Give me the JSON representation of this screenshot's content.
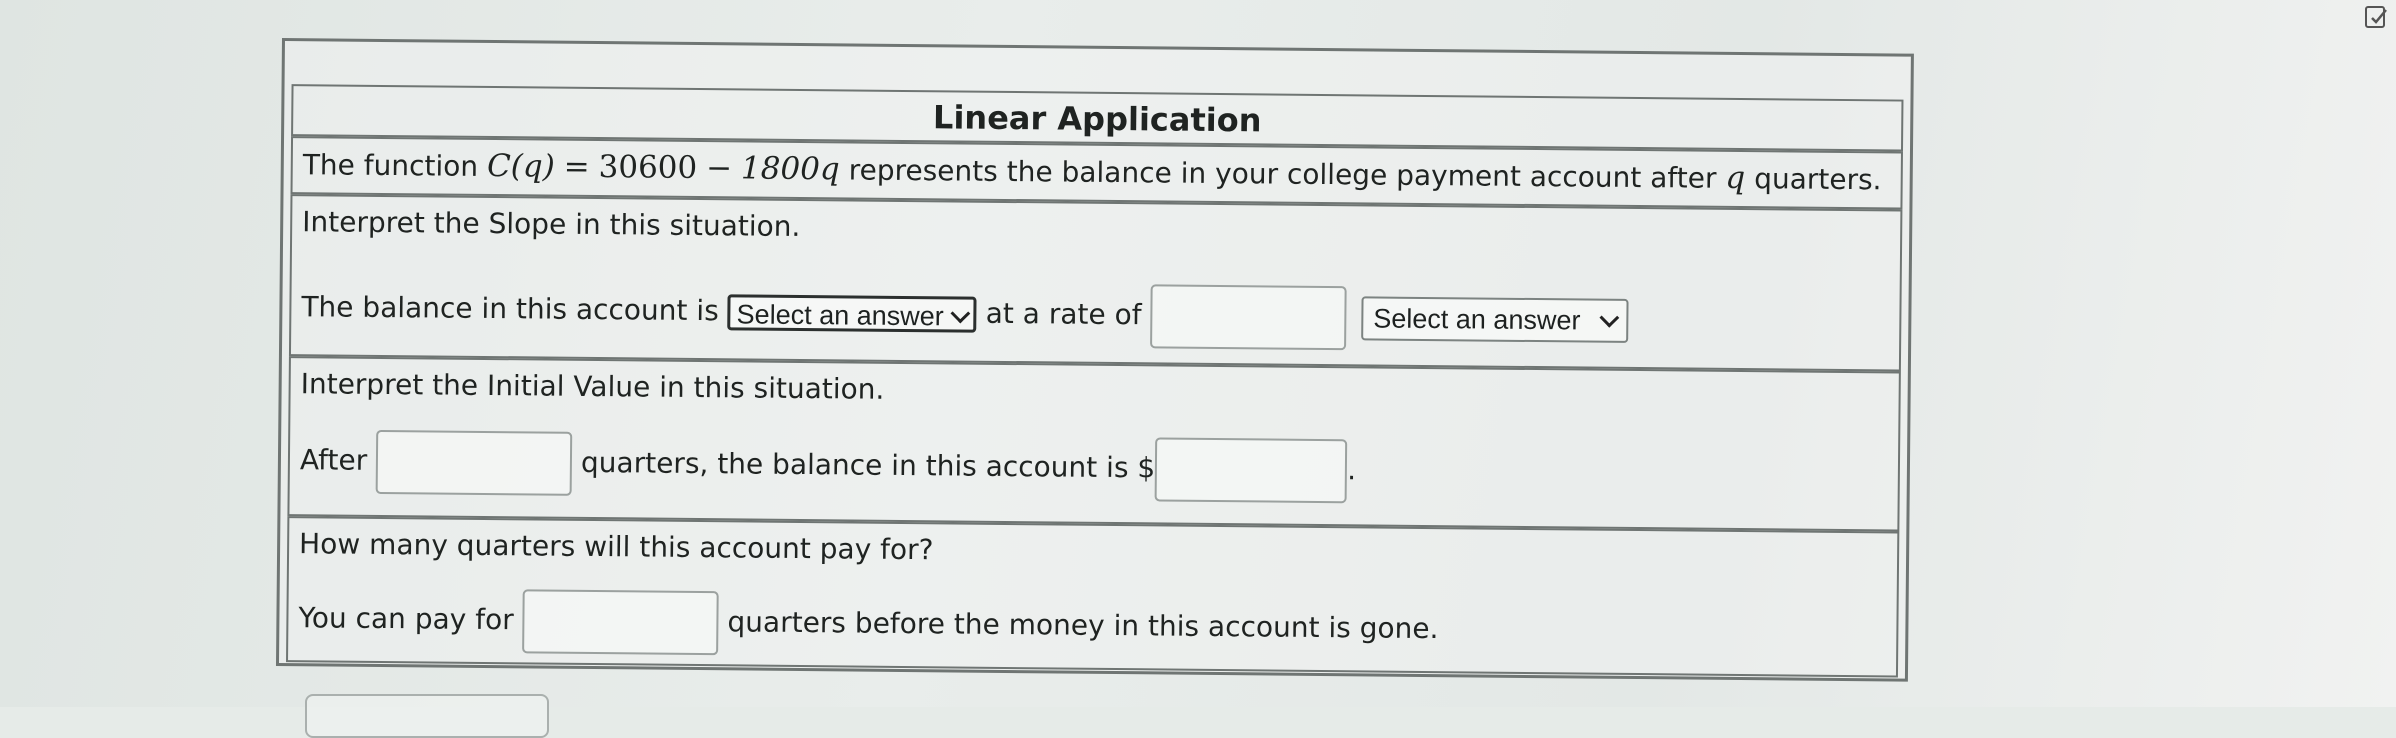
{
  "problem": {
    "title": "Linear Application",
    "statement": {
      "prefix": "The function",
      "func": "C(q)",
      "equals": "=",
      "const": "30600",
      "minus": "−",
      "term": "1800q",
      "middle": "represents the balance in your college payment account after",
      "var": "q",
      "suffix": "quarters."
    },
    "slope": {
      "prompt": "Interpret the Slope in this situation.",
      "lead": "The balance in this account is",
      "select1": "Select an answer",
      "rate_text": "at a rate of",
      "rate_value": "",
      "select2": "Select an answer"
    },
    "initial": {
      "prompt": "Interpret the Initial Value in this situation.",
      "after": "After",
      "quarters_value": "",
      "middle": "quarters, the balance in this account is $",
      "balance_value": "",
      "period": "."
    },
    "quarters": {
      "prompt": "How many quarters will this account pay for?",
      "lead": "You can pay for",
      "value": "",
      "tail": "quarters before the money in this account is gone."
    }
  },
  "icons": {
    "corner": "edit-icon"
  },
  "colors": {
    "border": "#6f7573",
    "text": "#1f2321"
  }
}
